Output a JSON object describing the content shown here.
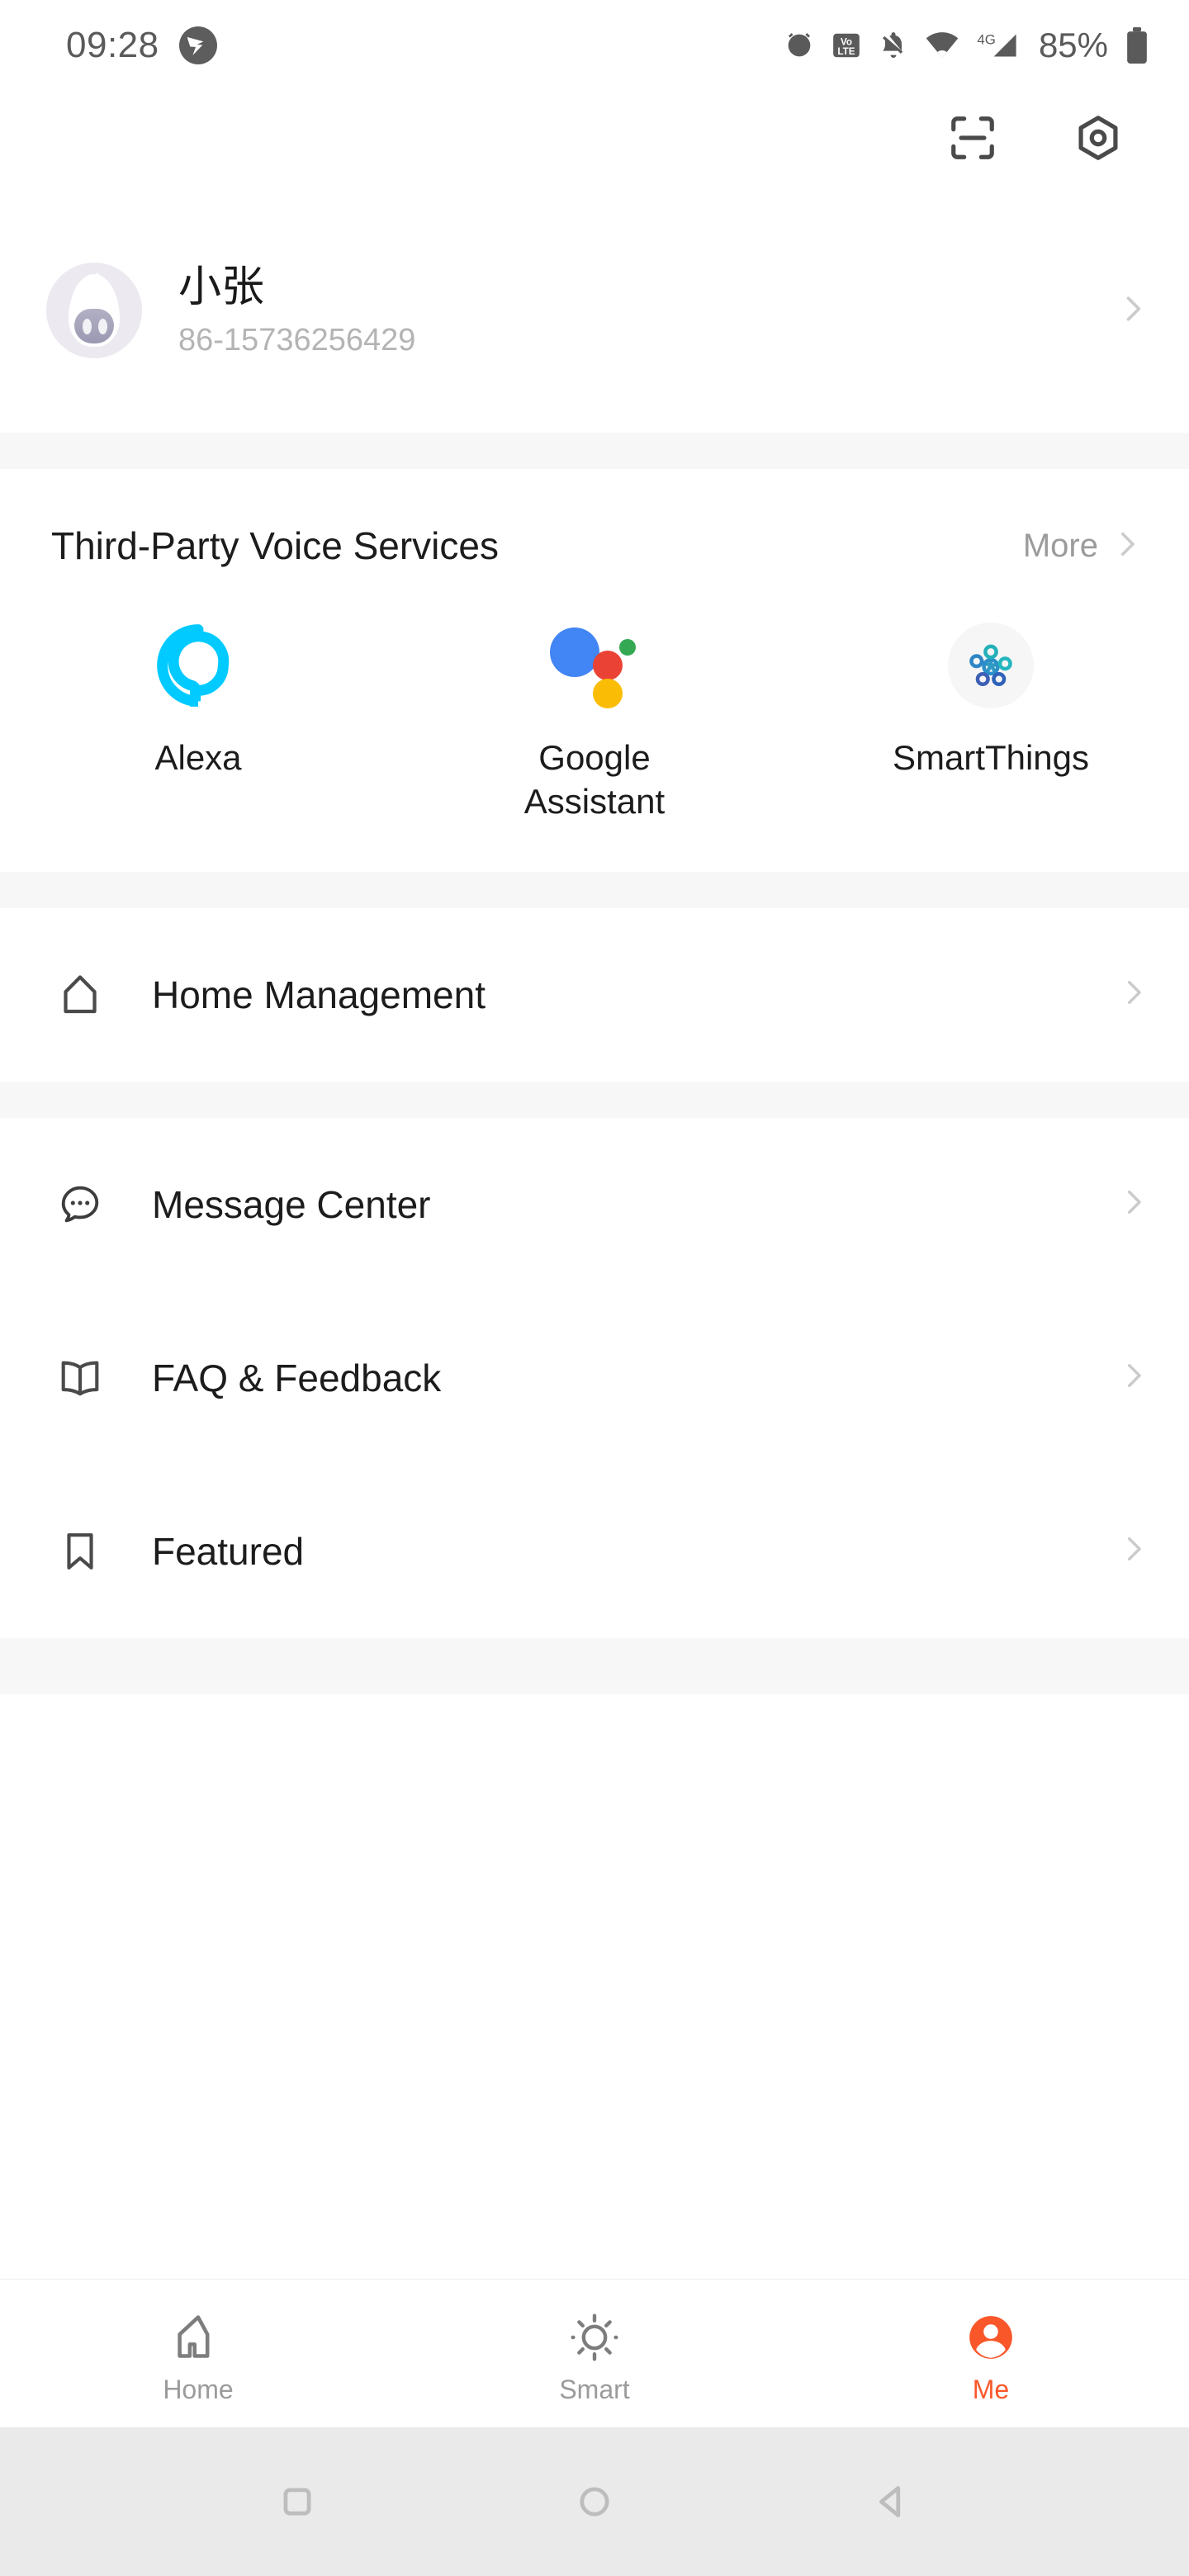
{
  "status_bar": {
    "time": "09:28",
    "battery_percent": "85%",
    "icons": [
      "app-notification-icon",
      "alarm-icon",
      "volte-icon",
      "mute-icon",
      "wifi-icon",
      "signal-4g-icon",
      "battery-icon"
    ]
  },
  "header": {
    "scan_icon": "scan-icon",
    "settings_icon": "hexagon-settings-icon"
  },
  "profile": {
    "name": "小张",
    "phone": "86-15736256429",
    "avatar_icon": "avatar",
    "chevron": "chevron-right-icon"
  },
  "voice_services": {
    "title": "Third-Party Voice Services",
    "more_label": "More",
    "items": [
      {
        "label": "Alexa",
        "icon": "alexa-icon",
        "color": "#00CAFF"
      },
      {
        "label": "Google Assistant",
        "icon": "google-assistant-icon",
        "color": "#4285F4"
      },
      {
        "label": "SmartThings",
        "icon": "smartthings-icon",
        "color": "#2E9BC4"
      }
    ]
  },
  "menu_primary": [
    {
      "label": "Home Management",
      "icon": "home-outline-icon"
    }
  ],
  "menu_secondary": [
    {
      "label": "Message Center",
      "icon": "chat-bubble-icon"
    },
    {
      "label": "FAQ & Feedback",
      "icon": "book-icon"
    },
    {
      "label": "Featured",
      "icon": "bookmark-icon"
    }
  ],
  "tabbar": {
    "active_color": "#F9572A",
    "inactive_color": "#9B9B9B",
    "tabs": [
      {
        "label": "Home",
        "icon": "home-icon",
        "active": false
      },
      {
        "label": "Smart",
        "icon": "sun-icon",
        "active": false
      },
      {
        "label": "Me",
        "icon": "person-icon",
        "active": true
      }
    ]
  },
  "android_nav": {
    "buttons": [
      {
        "icon": "recents-square-icon"
      },
      {
        "icon": "home-circle-icon"
      },
      {
        "icon": "back-triangle-icon"
      }
    ]
  }
}
